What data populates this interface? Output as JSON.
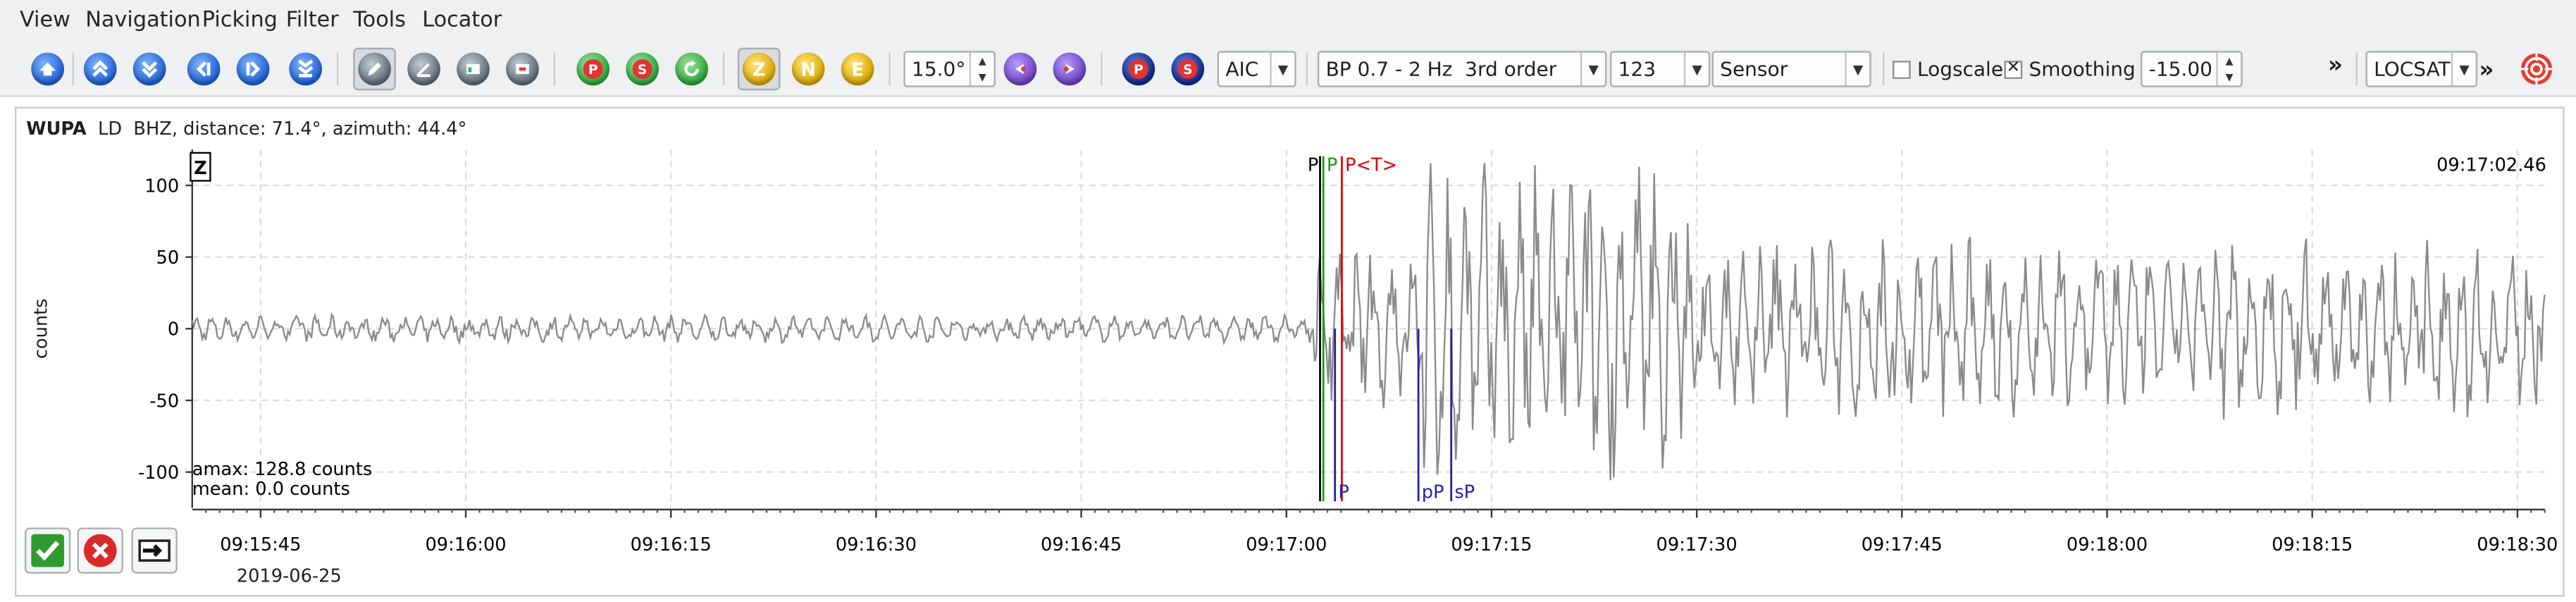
{
  "menu": [
    "View",
    "Navigation",
    "Picking",
    "Filter",
    "Tools",
    "Locator"
  ],
  "toolbar": {
    "angle_value": "15.0°",
    "picker_method": "AIC",
    "filter": "BP 0.7 - 2 Hz  3rd order",
    "filter_index": "123",
    "unit_mode": "Sensor",
    "logscale_label": "Logscale",
    "logscale_checked": false,
    "smoothing_label": "Smoothing",
    "smoothing_checked": true,
    "offset_value": "-15.00",
    "more_glyph": "»",
    "locator": "LOCSAT",
    "component_z": "Z",
    "component_n": "N",
    "component_e": "E",
    "pick_p": "P",
    "pick_s": "S"
  },
  "trace": {
    "station": "WUPA",
    "info": "LD  BHZ, distance: 71.4°, azimuth: 44.4°",
    "component_box": "Z",
    "y_axis_label": "counts",
    "current_time": "09:17:02.46",
    "amax": "amax: 128.8 counts",
    "mean": "mean: 0.0 counts",
    "date": "2019-06-25",
    "picks_top": [
      {
        "label": "P",
        "time": "09:17:02.46",
        "color": "#000000"
      },
      {
        "label": "P",
        "time": "09:17:02.46",
        "color": "#1a9a1a"
      },
      {
        "label": "P<T>",
        "time": "09:17:04.05",
        "color": "#e00000"
      }
    ],
    "theoretical_picks": [
      {
        "label": "P",
        "time": "09:17:03.55"
      },
      {
        "label": "pP",
        "time": "09:17:09.65"
      },
      {
        "label": "sP",
        "time": "09:17:12.05"
      }
    ]
  },
  "chart_data": {
    "type": "line",
    "ylabel": "counts",
    "ylim": [
      -125,
      125
    ],
    "yticks": [
      -100,
      -50,
      0,
      50,
      100
    ],
    "xlim": [
      "09:15:40",
      "09:18:32"
    ],
    "xticks": [
      "09:15:45",
      "09:16:00",
      "09:16:15",
      "09:16:30",
      "09:16:45",
      "09:17:00",
      "09:17:15",
      "09:17:30",
      "09:17:45",
      "09:18:00",
      "09:18:15",
      "09:18:30"
    ],
    "grid": true,
    "series": [
      {
        "color": "#8a8a8a",
        "segments": [
          {
            "from": "09:15:40",
            "to": "09:17:02",
            "amplitude": 10
          },
          {
            "from": "09:17:02",
            "to": "09:17:10",
            "amplitude": 60
          },
          {
            "from": "09:17:10",
            "to": "09:17:30",
            "amplitude": 120
          },
          {
            "from": "09:17:30",
            "to": "09:18:32",
            "amplitude": 65
          }
        ]
      }
    ]
  },
  "colors": {
    "accent_blue": "#1f5fd1",
    "theoretical_pick": "#2222aa",
    "manual_pick": "#000000",
    "auto_pick": "#1a9a1a",
    "theory_pick_red": "#e00000",
    "trace": "#8a8a8a"
  },
  "icons": {
    "home": "home-icon",
    "prev_arrow": "previous-icon",
    "next_arrow": "next-icon",
    "accept": "check-icon",
    "reject": "cancel-icon",
    "relocate": "send-icon"
  }
}
